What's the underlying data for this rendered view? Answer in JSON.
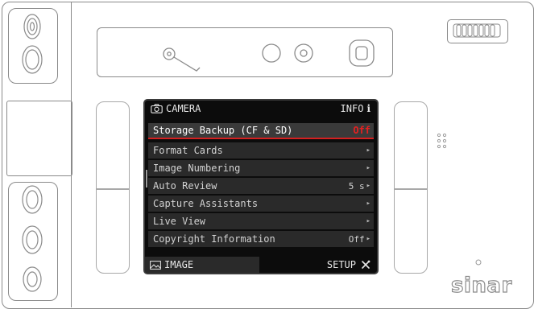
{
  "screen": {
    "header": {
      "title": "CAMERA",
      "info_label": "INFO",
      "info_glyph": "i",
      "camera_icon": "camera-icon"
    },
    "items": [
      {
        "label": "Storage Backup (CF & SD)",
        "value": "Off",
        "selected": true
      },
      {
        "label": "Format Cards",
        "value": ""
      },
      {
        "label": "Image Numbering",
        "value": ""
      },
      {
        "label": "Auto Review",
        "value": "5 s"
      },
      {
        "label": "Capture Assistants",
        "value": ""
      },
      {
        "label": "Live View",
        "value": ""
      },
      {
        "label": "Copyright Information",
        "value": "Off"
      }
    ],
    "footer": {
      "image_tab": "IMAGE",
      "setup_tab": "SETUP",
      "image_icon": "image-icon",
      "setup_icon": "tools-icon"
    }
  },
  "brand": {
    "name": "sinar"
  },
  "colors": {
    "accent_red": "#e62020",
    "screen_bg": "#0c0c0c",
    "item_bg": "#2a2a2a",
    "outline": "#8a8a8a"
  }
}
